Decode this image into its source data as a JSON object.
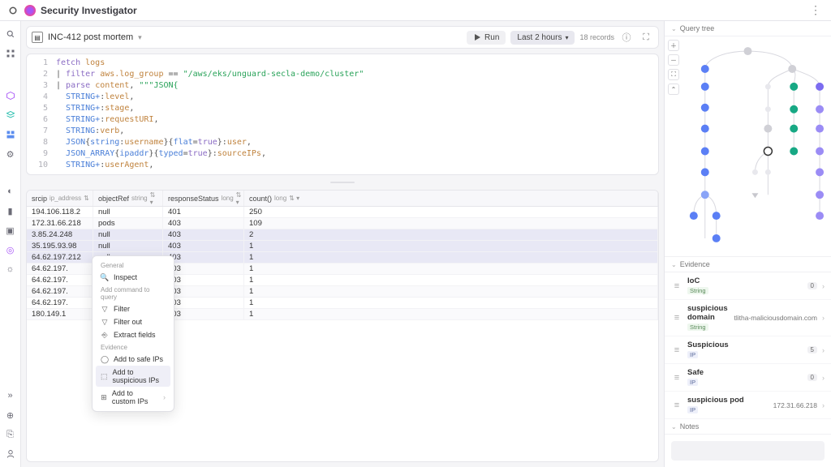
{
  "app": {
    "title": "Security Investigator"
  },
  "toolbar": {
    "investigation": "INC-412 post mortem",
    "run": "Run",
    "time_range": "Last 2 hours",
    "records": "18 records"
  },
  "editor": {
    "lines": [
      {
        "n": 1,
        "segs": [
          [
            "kw",
            "fetch"
          ],
          [
            "txt",
            " "
          ],
          [
            "id",
            "logs"
          ]
        ]
      },
      {
        "n": 2,
        "segs": [
          [
            "txt",
            "| "
          ],
          [
            "kw",
            "filter"
          ],
          [
            "txt",
            " "
          ],
          [
            "id",
            "aws.log_group"
          ],
          [
            "txt",
            " == "
          ],
          [
            "str",
            "\"/aws/eks/unguard-secla-demo/cluster\""
          ]
        ]
      },
      {
        "n": 3,
        "segs": [
          [
            "txt",
            "| "
          ],
          [
            "kw",
            "parse"
          ],
          [
            "txt",
            " "
          ],
          [
            "id",
            "content"
          ],
          [
            "txt",
            ", "
          ],
          [
            "str",
            "\"\"\"JSON{"
          ]
        ]
      },
      {
        "n": 4,
        "segs": [
          [
            "txt",
            "  "
          ],
          [
            "fn",
            "STRING+"
          ],
          [
            "txt",
            ":"
          ],
          [
            "id",
            "level"
          ],
          [
            "txt",
            ","
          ]
        ]
      },
      {
        "n": 5,
        "segs": [
          [
            "txt",
            "  "
          ],
          [
            "fn",
            "STRING+"
          ],
          [
            "txt",
            ":"
          ],
          [
            "id",
            "stage"
          ],
          [
            "txt",
            ","
          ]
        ]
      },
      {
        "n": 6,
        "segs": [
          [
            "txt",
            "  "
          ],
          [
            "fn",
            "STRING+"
          ],
          [
            "txt",
            ":"
          ],
          [
            "id",
            "requestURI"
          ],
          [
            "txt",
            ","
          ]
        ]
      },
      {
        "n": 7,
        "segs": [
          [
            "txt",
            "  "
          ],
          [
            "fn",
            "STRING"
          ],
          [
            "txt",
            ":"
          ],
          [
            "id",
            "verb"
          ],
          [
            "txt",
            ","
          ]
        ]
      },
      {
        "n": 8,
        "segs": [
          [
            "txt",
            "  "
          ],
          [
            "fn",
            "JSON"
          ],
          [
            "txt",
            "{"
          ],
          [
            "fn",
            "string"
          ],
          [
            "txt",
            ":"
          ],
          [
            "id",
            "username"
          ],
          [
            "txt",
            "}{"
          ],
          [
            "fn",
            "flat"
          ],
          [
            "txt",
            "="
          ],
          [
            "kw",
            "true"
          ],
          [
            "txt",
            "}:"
          ],
          [
            "id",
            "user"
          ],
          [
            "txt",
            ","
          ]
        ]
      },
      {
        "n": 9,
        "segs": [
          [
            "txt",
            "  "
          ],
          [
            "fn",
            "JSON_ARRAY"
          ],
          [
            "txt",
            "{"
          ],
          [
            "fn",
            "ipaddr"
          ],
          [
            "txt",
            "}{"
          ],
          [
            "fn",
            "typed"
          ],
          [
            "txt",
            "="
          ],
          [
            "kw",
            "true"
          ],
          [
            "txt",
            "}:"
          ],
          [
            "id",
            "sourceIPs"
          ],
          [
            "txt",
            ","
          ]
        ]
      },
      {
        "n": 10,
        "segs": [
          [
            "txt",
            "  "
          ],
          [
            "fn",
            "STRING+"
          ],
          [
            "txt",
            ":"
          ],
          [
            "id",
            "userAgent"
          ],
          [
            "txt",
            ","
          ]
        ]
      }
    ]
  },
  "table": {
    "columns": [
      {
        "name": "srcip",
        "type": "ip_address",
        "sort": "⇅"
      },
      {
        "name": "objectRef",
        "type": "string",
        "sort": "⇅ ▾"
      },
      {
        "name": "responseStatus",
        "type": "long",
        "sort": "⇅ ▾"
      },
      {
        "name": "count()",
        "type": "long",
        "sort": "⇅ ▾"
      }
    ],
    "rows": [
      {
        "c": [
          "194.106.118.2",
          "null",
          "401",
          "250"
        ],
        "sel": false
      },
      {
        "c": [
          "172.31.66.218",
          "pods",
          "403",
          "109"
        ],
        "sel": false
      },
      {
        "c": [
          "3.85.24.248",
          "null",
          "403",
          "2"
        ],
        "sel": true
      },
      {
        "c": [
          "35.195.93.98",
          "null",
          "403",
          "1"
        ],
        "sel": true
      },
      {
        "c": [
          "64.62.197.212",
          "null",
          "403",
          "1"
        ],
        "sel": true
      },
      {
        "c": [
          "64.62.197.",
          "",
          "403",
          "1"
        ],
        "sel": false
      },
      {
        "c": [
          "64.62.197.",
          "",
          "403",
          "1"
        ],
        "sel": false
      },
      {
        "c": [
          "64.62.197.",
          "",
          "403",
          "1"
        ],
        "sel": false
      },
      {
        "c": [
          "64.62.197.",
          "",
          "403",
          "1"
        ],
        "sel": false
      },
      {
        "c": [
          "180.149.1",
          "",
          "403",
          "1"
        ],
        "sel": false
      }
    ]
  },
  "context_menu": {
    "general": "General",
    "inspect": "Inspect",
    "add_cmd": "Add command to query",
    "filter": "Filter",
    "filter_out": "Filter out",
    "extract": "Extract fields",
    "evidence": "Evidence",
    "safe": "Add to safe IPs",
    "suspicious": "Add to suspicious IPs",
    "custom": "Add to custom IPs"
  },
  "right": {
    "tree_header": "Query tree",
    "evidence_header": "Evidence",
    "notes_header": "Notes",
    "items": [
      {
        "name": "IoC",
        "type": "String",
        "type_cls": "",
        "count": "0",
        "value": ""
      },
      {
        "name": "suspicious domain",
        "type": "String",
        "type_cls": "",
        "count": "",
        "value": "tlitha-maliciousdomain.com"
      },
      {
        "name": "Suspicious",
        "type": "IP",
        "type_cls": "ip",
        "count": "5",
        "value": ""
      },
      {
        "name": "Safe",
        "type": "IP",
        "type_cls": "ip",
        "count": "0",
        "value": ""
      },
      {
        "name": "suspicious pod",
        "type": "IP",
        "type_cls": "ip",
        "count": "",
        "value": "172.31.66.218"
      }
    ]
  }
}
